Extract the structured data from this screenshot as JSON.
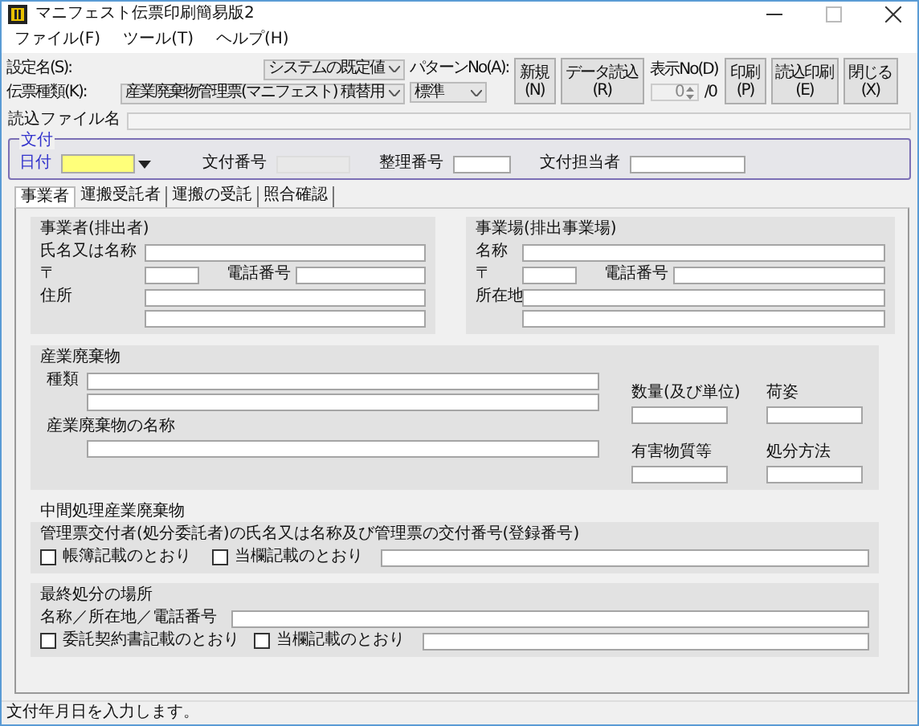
{
  "window": {
    "title": "マニフェスト伝票印刷簡易版2"
  },
  "menu": [
    {
      "label": "ファイル(F)"
    },
    {
      "label": "ツール(T)"
    },
    {
      "label": "ヘルプ(H)"
    }
  ],
  "toolbar": {
    "setting": {
      "label": "設定名(S):",
      "value": "システムの既定値"
    },
    "slip_type": {
      "label": "伝票種類(K):",
      "value": "産業廃棄物管理票(マニフェスト) 積替用"
    },
    "pattern": {
      "label": "パターンNo(A):",
      "value": "標準"
    },
    "buttons_left": [
      "新規(N)",
      "データ読込(R)"
    ],
    "display_no": {
      "label": "表示No(D)",
      "value": "0",
      "total": "/0",
      "disabled": true
    },
    "buttons_right": [
      "印刷(P)",
      "読込印刷(E)",
      "閉じる(X)"
    ]
  },
  "read_file": {
    "label": "読込ファイル名"
  },
  "issue": {
    "title": "文付",
    "date_label": "日付",
    "fields": [
      {
        "label": "文付番号",
        "disabled": true
      },
      {
        "label": "整理番号",
        "disabled": false
      },
      {
        "label": "文付担当者",
        "disabled": false
      }
    ]
  },
  "tabs": [
    {
      "label": "事業者",
      "selected": true
    },
    {
      "label": "運搬受託者",
      "selected": false
    },
    {
      "label": "運搬の受託",
      "selected": false
    },
    {
      "label": "照合確認",
      "selected": false
    }
  ],
  "parties": [
    {
      "title": "事業者(排出者)",
      "name_label": "氏名又は名称",
      "postal_label": "〒",
      "phone_label": "電話番号",
      "address_label": "住所"
    },
    {
      "title": "事業場(排出事業場)",
      "name_label": "名称",
      "postal_label": "〒",
      "phone_label": "電話番号",
      "address_label": "所在地"
    }
  ],
  "waste": {
    "title": "産業廃棄物",
    "type_label": "種類",
    "name_label": "産業廃棄物の名称",
    "quantity_label": "数量(及び単位)",
    "packaging_label": "荷姿",
    "hazardous_label": "有害物質等",
    "disposal_method_label": "処分方法"
  },
  "intermediate": {
    "title": "中間処理産業廃棄物",
    "description": "管理票交付者(処分委託者)の氏名又は名称及び管理票の交付番号(登録番号)",
    "checkboxes": [
      {
        "label": "帳簿記載のとおり",
        "checked": false
      },
      {
        "label": "当欄記載のとおり",
        "checked": false
      }
    ]
  },
  "final_disposal": {
    "title": "最終処分の場所",
    "name_label": "名称／所在地／電話番号",
    "checkboxes": [
      {
        "label": "委託契約書記載のとおり",
        "checked": false
      },
      {
        "label": "当欄記載のとおり",
        "checked": false
      }
    ]
  },
  "status_bar": {
    "text": "文付年月日を入力します。"
  }
}
